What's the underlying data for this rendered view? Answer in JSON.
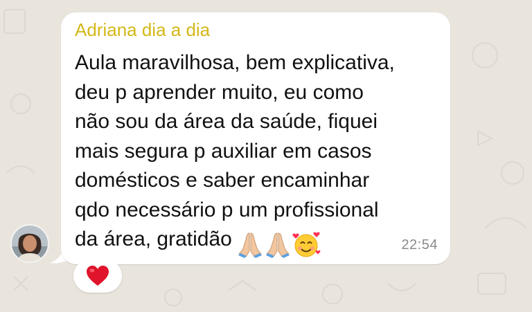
{
  "message": {
    "sender": "Adriana dia a dia",
    "lines": [
      "Aula maravilhosa, bem explicativa,",
      "deu p aprender muito, eu como",
      "não sou da área da saúde, fiquei",
      "mais segura p auxiliar em casos",
      "domésticos e  saber encaminhar",
      "qdo necessário p um profissional",
      "da área, gratidão"
    ],
    "emojis": [
      "folded-hands-icon",
      "folded-hands-icon",
      "smiling-face-with-hearts-icon"
    ],
    "time": "22:54"
  },
  "reaction": {
    "emoji": "red-heart-icon"
  },
  "colors": {
    "background": "#e9e5dd",
    "bubble": "#ffffff",
    "sender_name": "#d3b817",
    "text": "#111111",
    "timestamp": "#8a8a8a",
    "heart": "#e0142a"
  }
}
